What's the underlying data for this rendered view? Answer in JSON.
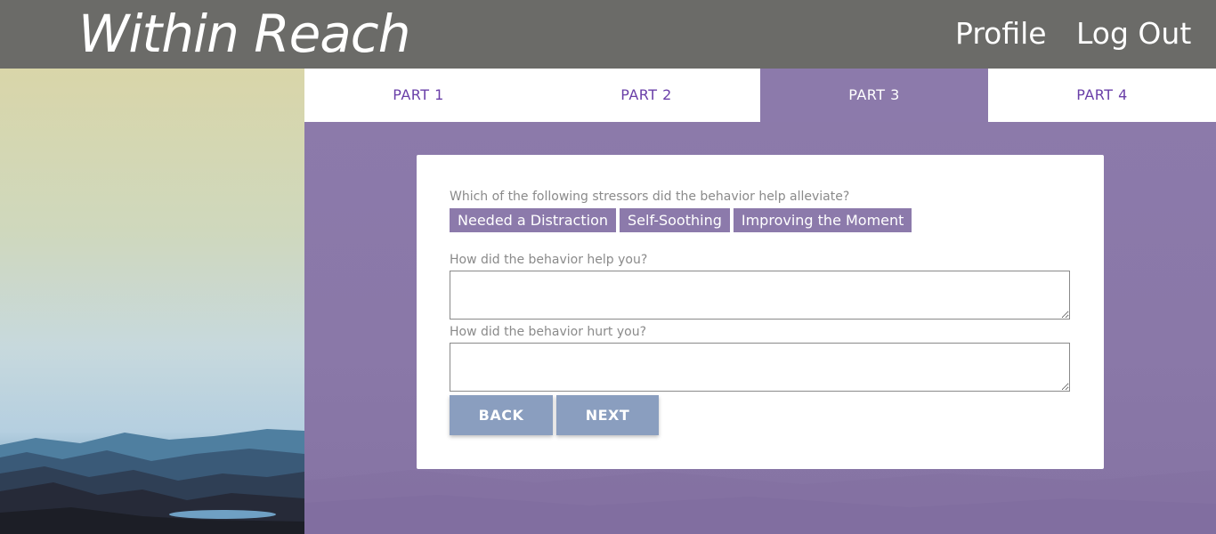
{
  "app": {
    "brand": "Within Reach"
  },
  "nav": {
    "profile": "Profile",
    "logout": "Log Out"
  },
  "tabs": [
    {
      "label": "PART 1",
      "active": false
    },
    {
      "label": "PART 2",
      "active": false
    },
    {
      "label": "PART 3",
      "active": true
    },
    {
      "label": "PART 4",
      "active": false
    }
  ],
  "form": {
    "stressors_question": "Which of the following stressors did the behavior help alleviate?",
    "stressor_options": [
      "Needed a Distraction",
      "Self-Soothing",
      "Improving the Moment"
    ],
    "help_question": "How did the behavior help you?",
    "help_value": "",
    "hurt_question": "How did the behavior hurt you?",
    "hurt_value": "",
    "back_label": "BACK",
    "next_label": "NEXT"
  },
  "colors": {
    "header_bg": "#6b6b68",
    "accent_purple": "#8c7aab",
    "tab_text": "#6a3fa8",
    "button_blue": "#8a9ebf"
  }
}
